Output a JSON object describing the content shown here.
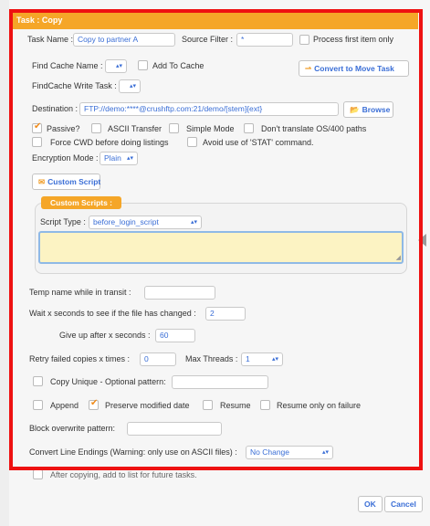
{
  "title": "Task : Copy",
  "task_name": {
    "label": "Task Name :",
    "value": "Copy to partner A"
  },
  "source_filter": {
    "label": "Source Filter :",
    "value": "*"
  },
  "process_first": {
    "label": "Process first item only",
    "checked": false
  },
  "find_cache": {
    "label": "Find Cache Name :"
  },
  "add_to_cache": {
    "label": "Add To Cache",
    "checked": false
  },
  "convert_move": {
    "label": "Convert to Move Task"
  },
  "findcache_write": {
    "label": "FindCache Write Task :"
  },
  "destination": {
    "label": "Destination :",
    "value": "FTP://demo:****@crushftp.com:21/demo/[stem]{ext}"
  },
  "browse": {
    "label": "Browse"
  },
  "passive": {
    "label": "Passive?",
    "checked": true
  },
  "ascii": {
    "label": "ASCII Transfer",
    "checked": false
  },
  "simple_mode": {
    "label": "Simple Mode",
    "checked": false
  },
  "no_translate": {
    "label": "Don't translate OS/400 paths",
    "checked": false
  },
  "force_cwd": {
    "label": "Force CWD before doing listings",
    "checked": false
  },
  "avoid_stat": {
    "label": "Avoid use of 'STAT' command.",
    "checked": false
  },
  "encryption": {
    "label": "Encryption Mode :",
    "value": "Plain"
  },
  "custom_script_btn": {
    "label": "Custom Script"
  },
  "custom_scripts": {
    "title": "Custom Scripts :",
    "script_type_label": "Script Type :",
    "script_type_value": "before_login_script"
  },
  "temp_name": {
    "label": "Temp name while in transit :",
    "value": ""
  },
  "wait_seconds": {
    "label": "Wait x seconds to see if the file has changed :",
    "value": "2"
  },
  "give_up": {
    "label": "Give up after x seconds :",
    "value": "60"
  },
  "retry": {
    "label": "Retry failed copies x times :",
    "value": "0"
  },
  "max_threads": {
    "label": "Max Threads :",
    "value": "1"
  },
  "copy_unique": {
    "label": "Copy Unique - Optional pattern:",
    "checked": false,
    "value": ""
  },
  "append": {
    "label": "Append",
    "checked": false
  },
  "preserve": {
    "label": "Preserve modified date",
    "checked": true
  },
  "resume": {
    "label": "Resume",
    "checked": false
  },
  "resume_fail": {
    "label": "Resume only on failure",
    "checked": false
  },
  "block_overwrite": {
    "label": "Block overwrite pattern:",
    "value": ""
  },
  "line_endings": {
    "label": "Convert Line Endings (Warning: only use on ASCII files) :",
    "value": "No Change"
  },
  "after_copying": {
    "label": "After copying, add to list for future tasks.",
    "checked": false
  },
  "footer": {
    "ok": "OK",
    "cancel": "Cancel"
  },
  "icons": {
    "convert": "arrow-right-icon",
    "browse": "folder-icon",
    "script": "script-icon"
  },
  "colors": {
    "accent": "#f5a628",
    "frame": "#ee1111",
    "link": "#3a6ed6",
    "check": "#f08b1a"
  }
}
